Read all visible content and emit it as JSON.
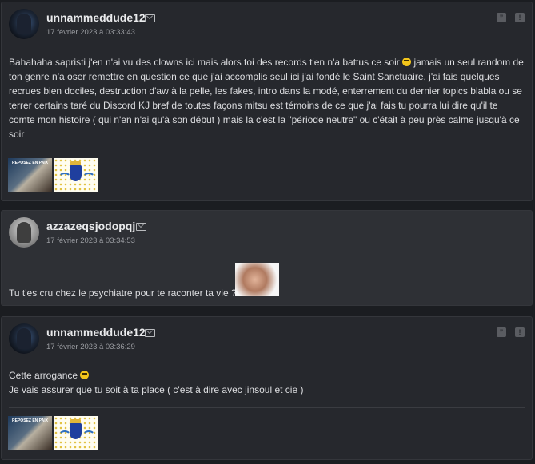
{
  "posts": [
    {
      "username": "unnammeddude12",
      "date": "17 février 2023 à 03:33:43",
      "body": [
        "Bahahaha sapristi j'en n'ai vu des clowns ici mais alors toi des records t'en n'a battus ce soir",
        "jamais un seul random de ton genre n'a oser remettre en question ce que j'ai accomplis seul ici j'ai fondé le Saint Sanctuaire, j'ai fais quelques recrues bien dociles, destruction d'aw à la pelle, les fakes, intro dans la modé, enterrement du dernier topics blabla ou se terrer certains taré du Discord KJ bref de toutes façons mitsu est témoins de ce que j'ai fais tu pourra lui dire qu'il te comte mon histoire ( qui n'en n'ai qu'à son début ) mais la c'est la \"période neutre\" ou c'était à peu près calme jusqu'à ce soir"
      ],
      "sticker_rip_text": "REPOSEZ EN PAIX"
    },
    {
      "username": "azzazeqsjodopqj",
      "date": "17 février 2023 à 03:34:53",
      "body": "Tu t'es cru chez le psychiatre pour te raconter ta vie ?"
    },
    {
      "username": "unnammeddude12",
      "date": "17 février 2023 à 03:36:29",
      "line1": "Cette arrogance",
      "line2": "Je vais assurer que tu soit à ta place ( c'est à dire avec jinsoul et cie )",
      "sticker_rip_text": "REPOSEZ EN PAIX"
    }
  ],
  "icons": {
    "mail": "mail-icon",
    "quote": "quote-icon",
    "report": "report-icon"
  },
  "colors": {
    "background": "#1b1d21",
    "post": "#26282d",
    "post_alt": "#2e3035",
    "emoji": "#f2c51b"
  }
}
